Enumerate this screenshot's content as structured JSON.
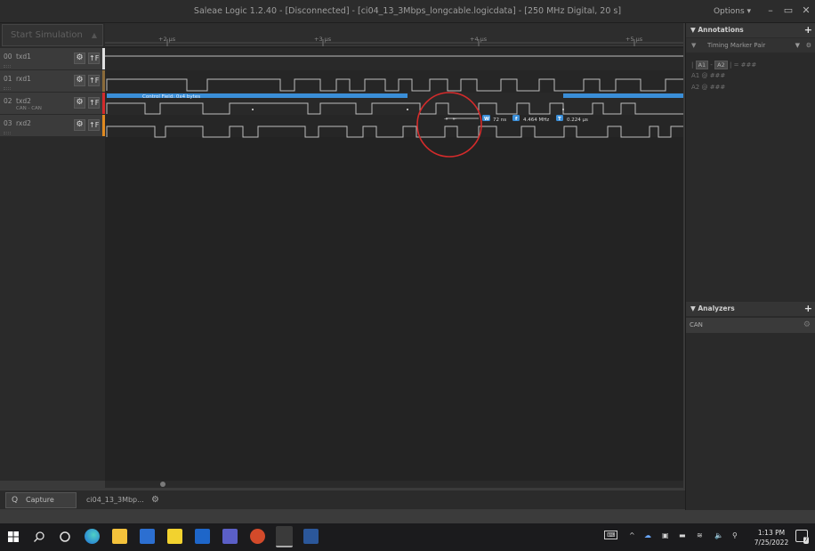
{
  "window": {
    "title": "Saleae Logic 1.2.40 - [Disconnected] - [ci04_13_3Mbps_longcable.logicdata] - [250 MHz Digital, 20 s]",
    "options_label": "Options ▾",
    "min": "–",
    "max": "▭",
    "close": "✕"
  },
  "sim_button": "Start Simulation",
  "channels": [
    {
      "num": "00",
      "name": "txd1",
      "sub": "",
      "color": "#e0e0e0"
    },
    {
      "num": "01",
      "name": "rxd1",
      "sub": "",
      "color": "#8b6b3a"
    },
    {
      "num": "02",
      "name": "txd2",
      "sub": "CAN - CAN",
      "color": "#d42b2b"
    },
    {
      "num": "03",
      "name": "rxd2",
      "sub": "",
      "color": "#e08a20"
    }
  ],
  "gear_glyph": "⚙",
  "trig_glyph": "↑F",
  "ruler_ticks": [
    "+2 µs",
    "+3 µs",
    "+4 µs",
    "+5 µs"
  ],
  "decode_label": "Control Field: 0x4 bytes",
  "measure": {
    "w_label": "W",
    "w_value": "72 ns",
    "f_label": "f",
    "f_value": "4.464 MHz",
    "t_label": "T",
    "t_value": "0.224 µs"
  },
  "bottom": {
    "capture_label": "Capture",
    "file_tab": "ci04_13_3Mbp...",
    "capture_icon": "Q",
    "gear": "⚙"
  },
  "annotations": {
    "header": "▼ Annotations",
    "plus": "+",
    "filter_icon": "▼",
    "marker_label": "Timing Marker Pair",
    "dropdown": "▼",
    "gear": "⚙",
    "row1_a1": "A1",
    "row1_a2": "A2",
    "row1_text": "| = ###",
    "row2": "A1  @  ###",
    "row3": "A2  @  ###"
  },
  "analyzers": {
    "header": "▼ Analyzers",
    "plus": "+",
    "item": "CAN",
    "gear": "⚙"
  },
  "taskbar": {
    "time": "1:13 PM",
    "date": "7/25/2022",
    "notif": "7"
  },
  "colors": {
    "accent_blue": "#3a8ed8",
    "highlight_red": "#d42b2b",
    "waveform": "#cfcfcf"
  }
}
